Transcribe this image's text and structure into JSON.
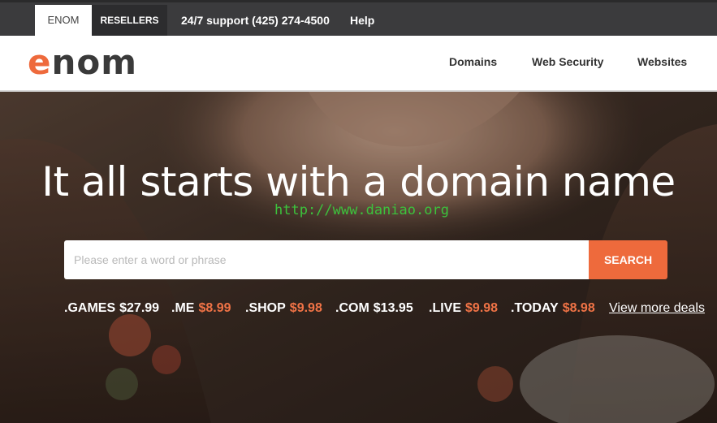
{
  "topbar": {
    "tabs": [
      "ENOM",
      "RESELLERS"
    ],
    "support": "24/7 support (425) 274-4500",
    "help": "Help"
  },
  "header": {
    "logo_e": "e",
    "logo_rest": "nom",
    "nav": [
      "Domains",
      "Web Security",
      "Websites"
    ]
  },
  "hero": {
    "headline": "It all starts with a domain name",
    "watermark": "http://www.daniao.org",
    "search": {
      "placeholder": "Please enter a word or phrase",
      "button": "SEARCH"
    },
    "deals": [
      {
        "tld": ".GAMES",
        "price": "$27.99"
      },
      {
        "tld": ".ME",
        "price": "$8.99"
      },
      {
        "tld": ".SHOP",
        "price": "$9.98"
      },
      {
        "tld": ".COM",
        "price": "$13.95"
      },
      {
        "tld": ".LIVE",
        "price": "$9.98"
      },
      {
        "tld": ".TODAY",
        "price": "$8.98"
      }
    ],
    "view_more": "View more deals"
  },
  "colors": {
    "accent": "#ee6a3c",
    "topbar": "#3b3b3d"
  }
}
